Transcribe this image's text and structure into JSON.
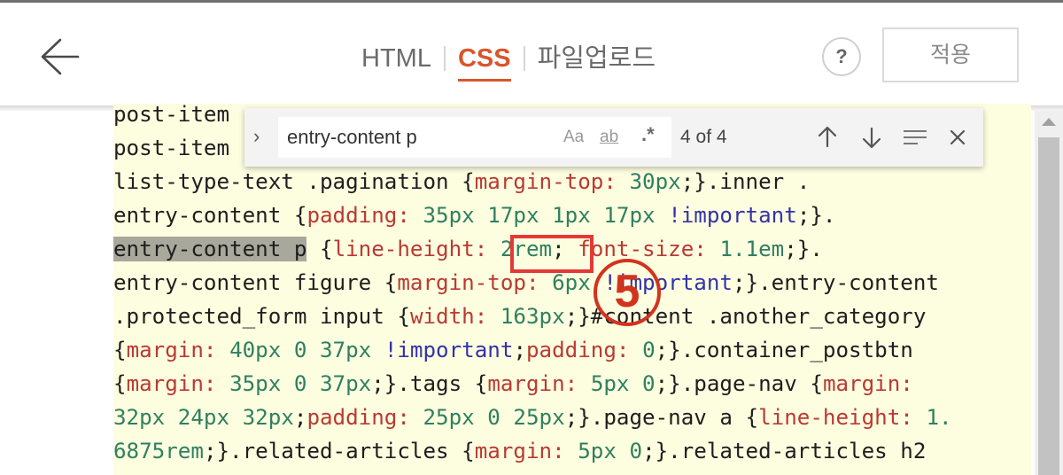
{
  "header": {
    "tabs": [
      {
        "label": "HTML"
      },
      {
        "label": "CSS"
      },
      {
        "label": "파일업로드"
      }
    ],
    "help_label": "?",
    "apply_label": "적용"
  },
  "find": {
    "value": "entry-content p",
    "match_case": "Aa",
    "whole_word": "ab",
    "regex": ".*",
    "count": "4 of 4"
  },
  "annotation": {
    "number": "5"
  },
  "colors": {
    "accent": "#d9552c",
    "editor_bg": "#fdfde0",
    "property": "#b93a32",
    "number": "#2f8060",
    "keyword": "#3333a8",
    "highlight": "#a8a89c",
    "annotation_red": "#e53935"
  },
  "code": {
    "lines": [
      [
        {
          "t": "post-item"
        }
      ],
      [
        {
          "t": "post-item"
        }
      ],
      [
        {
          "t": "list-type-text .pagination {"
        },
        {
          "t": "margin-top:",
          "c": "prop"
        },
        {
          "t": " "
        },
        {
          "t": "30px",
          "c": "num"
        },
        {
          "t": ";}.inner ."
        }
      ],
      [
        {
          "t": "entry-content {"
        },
        {
          "t": "padding:",
          "c": "prop"
        },
        {
          "t": " "
        },
        {
          "t": "35px 17px 1px 17px",
          "c": "num"
        },
        {
          "t": " "
        },
        {
          "t": "!important",
          "c": "kw"
        },
        {
          "t": ";}."
        }
      ],
      [
        {
          "t": "entry-content p",
          "c": "hl"
        },
        {
          "t": " {"
        },
        {
          "t": "line-height:",
          "c": "prop"
        },
        {
          "t": " "
        },
        {
          "t": "2rem",
          "c": "num"
        },
        {
          "t": "; "
        },
        {
          "t": "font-size:",
          "c": "prop"
        },
        {
          "t": " "
        },
        {
          "t": "1.1em",
          "c": "num"
        },
        {
          "t": ";}."
        }
      ],
      [
        {
          "t": "entry-content figure {"
        },
        {
          "t": "margin-top:",
          "c": "prop"
        },
        {
          "t": " "
        },
        {
          "t": "6px",
          "c": "num"
        },
        {
          "t": " "
        },
        {
          "t": "!important",
          "c": "kw"
        },
        {
          "t": ";}.entry-content"
        }
      ],
      [
        {
          "t": ".protected_form input {"
        },
        {
          "t": "width:",
          "c": "prop"
        },
        {
          "t": " "
        },
        {
          "t": "163px",
          "c": "num"
        },
        {
          "t": ";}#content .another_category"
        }
      ],
      [
        {
          "t": "{"
        },
        {
          "t": "margin:",
          "c": "prop"
        },
        {
          "t": " "
        },
        {
          "t": "40px 0 37px",
          "c": "num"
        },
        {
          "t": " "
        },
        {
          "t": "!important",
          "c": "kw"
        },
        {
          "t": ";"
        },
        {
          "t": "padding:",
          "c": "prop"
        },
        {
          "t": " "
        },
        {
          "t": "0",
          "c": "num"
        },
        {
          "t": ";}.container_postbtn"
        }
      ],
      [
        {
          "t": "{"
        },
        {
          "t": "margin:",
          "c": "prop"
        },
        {
          "t": " "
        },
        {
          "t": "35px 0 37px",
          "c": "num"
        },
        {
          "t": ";}.tags {"
        },
        {
          "t": "margin:",
          "c": "prop"
        },
        {
          "t": " "
        },
        {
          "t": "5px 0",
          "c": "num"
        },
        {
          "t": ";}.page-nav {"
        },
        {
          "t": "margin:",
          "c": "prop"
        }
      ],
      [
        {
          "t": "32px 24px 32px",
          "c": "num"
        },
        {
          "t": ";"
        },
        {
          "t": "padding:",
          "c": "prop"
        },
        {
          "t": " "
        },
        {
          "t": "25px 0 25px",
          "c": "num"
        },
        {
          "t": ";}.page-nav a {"
        },
        {
          "t": "line-height:",
          "c": "prop"
        },
        {
          "t": " "
        },
        {
          "t": "1.",
          "c": "num"
        }
      ],
      [
        {
          "t": "6875rem",
          "c": "num"
        },
        {
          "t": ";}.related-articles {"
        },
        {
          "t": "margin:",
          "c": "prop"
        },
        {
          "t": " "
        },
        {
          "t": "5px 0",
          "c": "num"
        },
        {
          "t": ";}.related-articles h2"
        }
      ]
    ]
  }
}
